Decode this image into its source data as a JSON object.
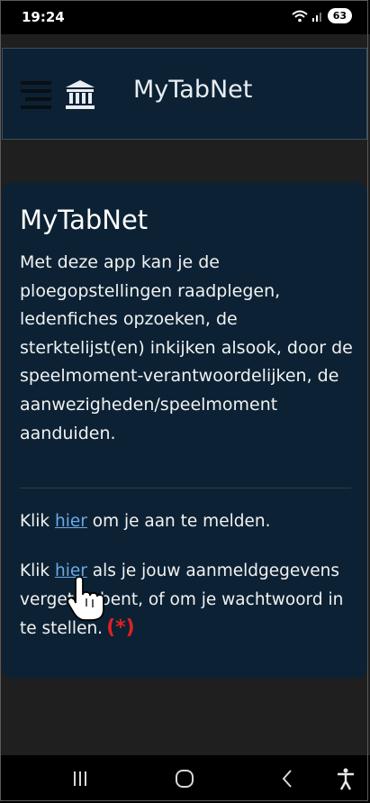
{
  "status_bar": {
    "time": "19:24",
    "battery": "63",
    "icons": [
      "wifi-icon",
      "signal-icon",
      "battery-icon"
    ]
  },
  "header": {
    "title": "MyTabNet",
    "icons": [
      "hamburger-menu-icon",
      "bank-icon"
    ]
  },
  "card": {
    "title": "MyTabNet",
    "description": "Met deze app kan je de ploegopstellingen raadplegen, ledenfiches opzoeken, de sterktelijst(en) inkijken alsook, door de speelmoment-verantwoordelijken, de aanwezigheden/speelmoment aanduiden.",
    "login": {
      "prefix": "Klik ",
      "link": "hier",
      "suffix": " om je aan te melden."
    },
    "reset": {
      "prefix": "Klik ",
      "link": "hier",
      "suffix": " als je jouw aanmeldgegevens vergeten bent, of om je wachtwoord in te stellen.",
      "marker": "(*)"
    }
  },
  "nav_bar": {
    "icons": [
      "recent-apps-icon",
      "home-icon",
      "back-icon",
      "accessibility-icon"
    ]
  },
  "colors": {
    "background": "#1f1f1f",
    "panel": "#0c2234",
    "link": "#6ba9ea",
    "marker": "#e02020"
  }
}
